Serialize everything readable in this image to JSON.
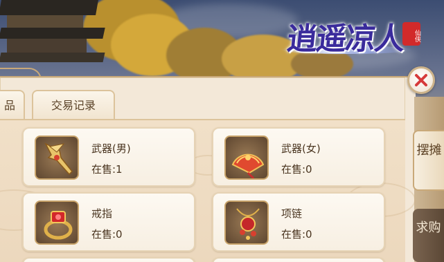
{
  "logo": {
    "title": "逍遥凉人",
    "seal": "仙侠"
  },
  "tabs": [
    {
      "label": "品"
    },
    {
      "label": "交易记录"
    }
  ],
  "items": [
    {
      "name": "武器(男)",
      "sale": "在售:1",
      "icon": "male-weapon-icon"
    },
    {
      "name": "武器(女)",
      "sale": "在售:0",
      "icon": "female-weapon-fan-icon"
    },
    {
      "name": "戒指",
      "sale": "在售:0",
      "icon": "ring-icon"
    },
    {
      "name": "项链",
      "sale": "在售:0",
      "icon": "necklace-icon"
    }
  ],
  "side_tabs": [
    {
      "label": "摆摊",
      "active": true
    },
    {
      "label": "求购",
      "active": false
    }
  ],
  "colors": {
    "accent_red": "#d63a3a",
    "panel": "#f3e8d8",
    "border": "#c9a979"
  }
}
